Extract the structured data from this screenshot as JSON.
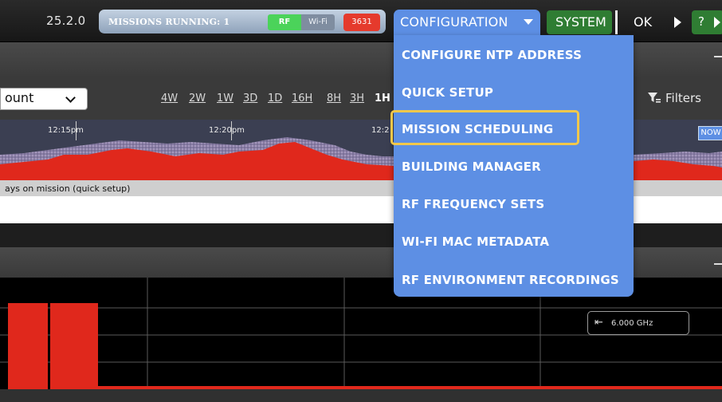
{
  "header": {
    "version": "25.2.0",
    "missions_running": "MISSIONS RUNNING: 1",
    "rf_label": "RF",
    "wifi_label": "Wi-Fi",
    "count": "3631",
    "configuration_label": "CONFIGURATION",
    "system_label": "SYSTEM",
    "ok_label": "OK",
    "help_label": "?"
  },
  "toolbar": {
    "count_select_value": "ount",
    "ranges": [
      "4W",
      "2W",
      "1W",
      "3D",
      "1D",
      "16H",
      "8H",
      "3H"
    ],
    "active_range": "1H",
    "filters_label": "Filters"
  },
  "timeline": {
    "labels": [
      "12:15pm",
      "12:20pm",
      "12:2"
    ],
    "now_label": "NOW",
    "mission_text": "ays on mission (quick setup)"
  },
  "spectrum": {
    "freq_label": "6.000 GHz"
  },
  "config_menu": {
    "items": [
      "CONFIGURE NTP ADDRESS",
      "QUICK SETUP",
      "MISSION SCHEDULING",
      "BUILDING MANAGER",
      "RF FREQUENCY SETS",
      "WI-FI MAC METADATA",
      "RF ENVIRONMENT RECORDINGS"
    ],
    "highlighted": "MISSION SCHEDULING"
  },
  "colors": {
    "accent": "#5d8fe4",
    "system_green": "#2f7d33",
    "rf_green": "#4bd35a",
    "alert_red": "#e53a2c",
    "highlight": "#f2c84b"
  }
}
